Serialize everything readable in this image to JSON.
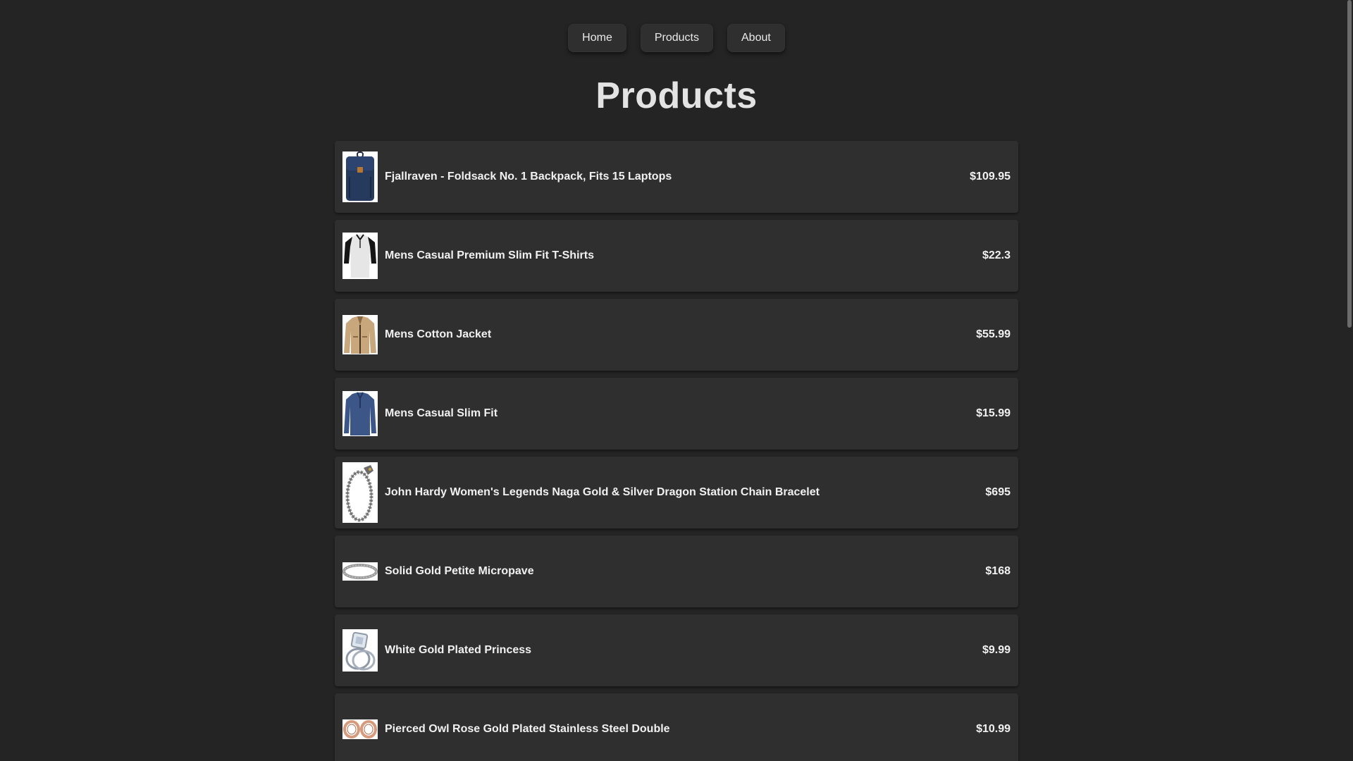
{
  "nav": {
    "items": [
      {
        "label": "Home"
      },
      {
        "label": "Products"
      },
      {
        "label": "About"
      }
    ]
  },
  "page": {
    "title": "Products"
  },
  "products": [
    {
      "name": "Fjallraven - Foldsack No. 1 Backpack, Fits 15 Laptops",
      "price": "$109.95",
      "icon": "backpack-icon"
    },
    {
      "name": "Mens Casual Premium Slim Fit T-Shirts",
      "price": "$22.3",
      "icon": "tshirt-icon"
    },
    {
      "name": "Mens Cotton Jacket",
      "price": "$55.99",
      "icon": "jacket-icon"
    },
    {
      "name": "Mens Casual Slim Fit",
      "price": "$15.99",
      "icon": "longsleeve-shirt-icon"
    },
    {
      "name": "John Hardy Women's Legends Naga Gold & Silver Dragon Station Chain Bracelet",
      "price": "$695",
      "icon": "bracelet-icon"
    },
    {
      "name": "Solid Gold Petite Micropave",
      "price": "$168",
      "icon": "ring-band-icon"
    },
    {
      "name": "White Gold Plated Princess",
      "price": "$9.99",
      "icon": "diamond-ring-icon"
    },
    {
      "name": "Pierced Owl Rose Gold Plated Stainless Steel Double",
      "price": "$10.99",
      "icon": "rose-gold-rings-icon"
    }
  ],
  "colors": {
    "background": "#242424",
    "card": "#2f2f2f",
    "text": "#f1f1f1"
  }
}
